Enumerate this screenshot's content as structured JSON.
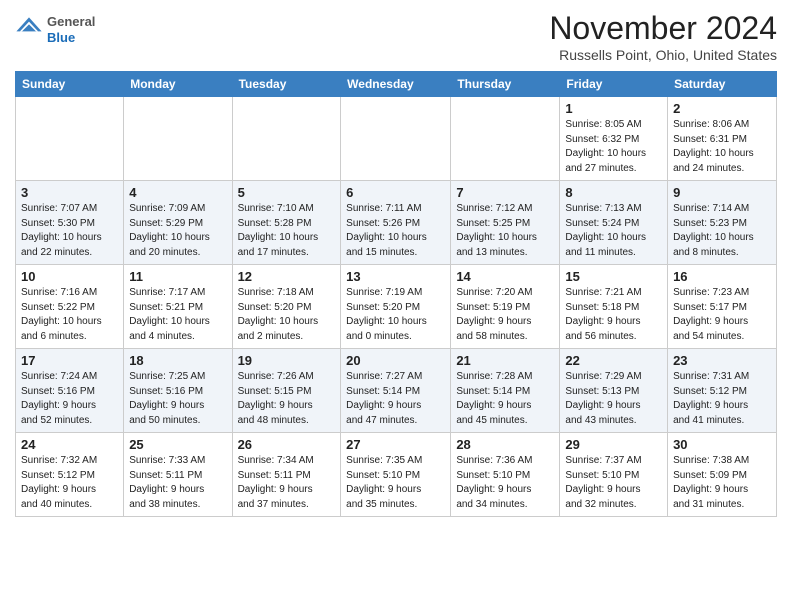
{
  "header": {
    "logo": {
      "general": "General",
      "blue": "Blue"
    },
    "title": "November 2024",
    "location": "Russells Point, Ohio, United States"
  },
  "weekdays": [
    "Sunday",
    "Monday",
    "Tuesday",
    "Wednesday",
    "Thursday",
    "Friday",
    "Saturday"
  ],
  "weeks": [
    [
      {
        "day": "",
        "info": ""
      },
      {
        "day": "",
        "info": ""
      },
      {
        "day": "",
        "info": ""
      },
      {
        "day": "",
        "info": ""
      },
      {
        "day": "",
        "info": ""
      },
      {
        "day": "1",
        "info": "Sunrise: 8:05 AM\nSunset: 6:32 PM\nDaylight: 10 hours\nand 27 minutes."
      },
      {
        "day": "2",
        "info": "Sunrise: 8:06 AM\nSunset: 6:31 PM\nDaylight: 10 hours\nand 24 minutes."
      }
    ],
    [
      {
        "day": "3",
        "info": "Sunrise: 7:07 AM\nSunset: 5:30 PM\nDaylight: 10 hours\nand 22 minutes."
      },
      {
        "day": "4",
        "info": "Sunrise: 7:09 AM\nSunset: 5:29 PM\nDaylight: 10 hours\nand 20 minutes."
      },
      {
        "day": "5",
        "info": "Sunrise: 7:10 AM\nSunset: 5:28 PM\nDaylight: 10 hours\nand 17 minutes."
      },
      {
        "day": "6",
        "info": "Sunrise: 7:11 AM\nSunset: 5:26 PM\nDaylight: 10 hours\nand 15 minutes."
      },
      {
        "day": "7",
        "info": "Sunrise: 7:12 AM\nSunset: 5:25 PM\nDaylight: 10 hours\nand 13 minutes."
      },
      {
        "day": "8",
        "info": "Sunrise: 7:13 AM\nSunset: 5:24 PM\nDaylight: 10 hours\nand 11 minutes."
      },
      {
        "day": "9",
        "info": "Sunrise: 7:14 AM\nSunset: 5:23 PM\nDaylight: 10 hours\nand 8 minutes."
      }
    ],
    [
      {
        "day": "10",
        "info": "Sunrise: 7:16 AM\nSunset: 5:22 PM\nDaylight: 10 hours\nand 6 minutes."
      },
      {
        "day": "11",
        "info": "Sunrise: 7:17 AM\nSunset: 5:21 PM\nDaylight: 10 hours\nand 4 minutes."
      },
      {
        "day": "12",
        "info": "Sunrise: 7:18 AM\nSunset: 5:20 PM\nDaylight: 10 hours\nand 2 minutes."
      },
      {
        "day": "13",
        "info": "Sunrise: 7:19 AM\nSunset: 5:20 PM\nDaylight: 10 hours\nand 0 minutes."
      },
      {
        "day": "14",
        "info": "Sunrise: 7:20 AM\nSunset: 5:19 PM\nDaylight: 9 hours\nand 58 minutes."
      },
      {
        "day": "15",
        "info": "Sunrise: 7:21 AM\nSunset: 5:18 PM\nDaylight: 9 hours\nand 56 minutes."
      },
      {
        "day": "16",
        "info": "Sunrise: 7:23 AM\nSunset: 5:17 PM\nDaylight: 9 hours\nand 54 minutes."
      }
    ],
    [
      {
        "day": "17",
        "info": "Sunrise: 7:24 AM\nSunset: 5:16 PM\nDaylight: 9 hours\nand 52 minutes."
      },
      {
        "day": "18",
        "info": "Sunrise: 7:25 AM\nSunset: 5:16 PM\nDaylight: 9 hours\nand 50 minutes."
      },
      {
        "day": "19",
        "info": "Sunrise: 7:26 AM\nSunset: 5:15 PM\nDaylight: 9 hours\nand 48 minutes."
      },
      {
        "day": "20",
        "info": "Sunrise: 7:27 AM\nSunset: 5:14 PM\nDaylight: 9 hours\nand 47 minutes."
      },
      {
        "day": "21",
        "info": "Sunrise: 7:28 AM\nSunset: 5:14 PM\nDaylight: 9 hours\nand 45 minutes."
      },
      {
        "day": "22",
        "info": "Sunrise: 7:29 AM\nSunset: 5:13 PM\nDaylight: 9 hours\nand 43 minutes."
      },
      {
        "day": "23",
        "info": "Sunrise: 7:31 AM\nSunset: 5:12 PM\nDaylight: 9 hours\nand 41 minutes."
      }
    ],
    [
      {
        "day": "24",
        "info": "Sunrise: 7:32 AM\nSunset: 5:12 PM\nDaylight: 9 hours\nand 40 minutes."
      },
      {
        "day": "25",
        "info": "Sunrise: 7:33 AM\nSunset: 5:11 PM\nDaylight: 9 hours\nand 38 minutes."
      },
      {
        "day": "26",
        "info": "Sunrise: 7:34 AM\nSunset: 5:11 PM\nDaylight: 9 hours\nand 37 minutes."
      },
      {
        "day": "27",
        "info": "Sunrise: 7:35 AM\nSunset: 5:10 PM\nDaylight: 9 hours\nand 35 minutes."
      },
      {
        "day": "28",
        "info": "Sunrise: 7:36 AM\nSunset: 5:10 PM\nDaylight: 9 hours\nand 34 minutes."
      },
      {
        "day": "29",
        "info": "Sunrise: 7:37 AM\nSunset: 5:10 PM\nDaylight: 9 hours\nand 32 minutes."
      },
      {
        "day": "30",
        "info": "Sunrise: 7:38 AM\nSunset: 5:09 PM\nDaylight: 9 hours\nand 31 minutes."
      }
    ]
  ]
}
